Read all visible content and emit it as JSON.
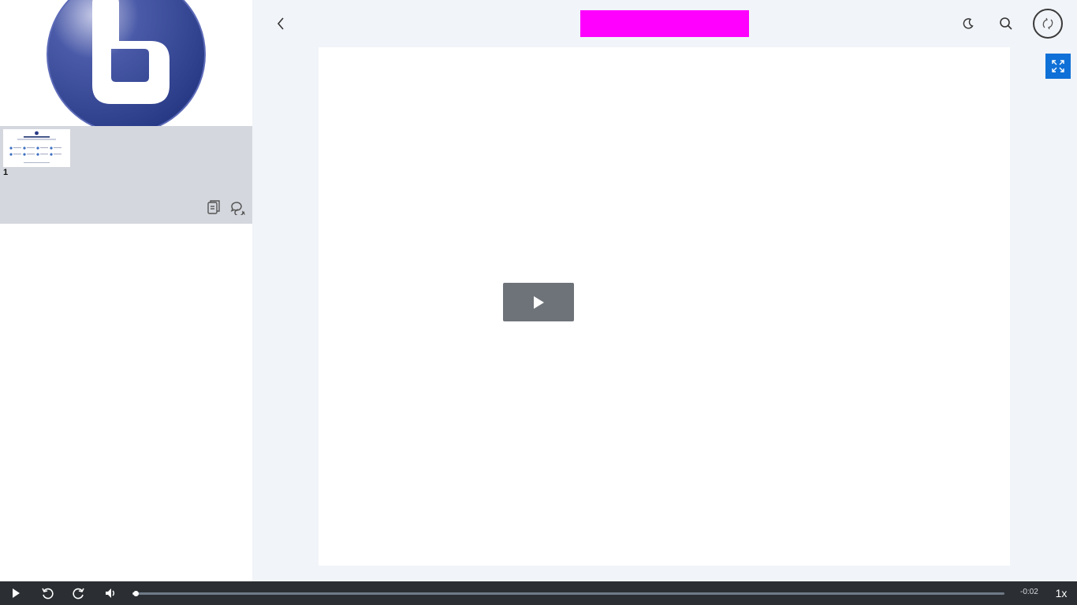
{
  "header": {
    "title": "",
    "back_icon": "chevron-left-icon",
    "theme_icon": "moon-icon",
    "search_icon": "search-icon",
    "swap_icon": "swap-layout-icon",
    "fullscreen_icon": "fullscreen-icon"
  },
  "sidebar": {
    "logo": "bigbluebutton-logo",
    "thumbnails": [
      {
        "number": "1",
        "alt": "slide-thumbnail"
      }
    ],
    "actions": [
      {
        "icon": "copy-icon"
      },
      {
        "icon": "chat-icon"
      }
    ]
  },
  "player": {
    "big_play_icon": "play-icon",
    "controls": {
      "play_icon": "play-icon",
      "rewind_icon": "rewind-icon",
      "forward_icon": "forward-icon",
      "volume_icon": "volume-icon",
      "remaining_time": "-0:02",
      "playback_rate": "1x",
      "progress_fraction": 0.003
    }
  },
  "colors": {
    "accent": "#0f70d7",
    "title_highlight": "#ff00ff",
    "control_bar": "#2b2f33",
    "sidebar_panel": "#d4d7dd",
    "main_bg": "#f1f4f8"
  }
}
